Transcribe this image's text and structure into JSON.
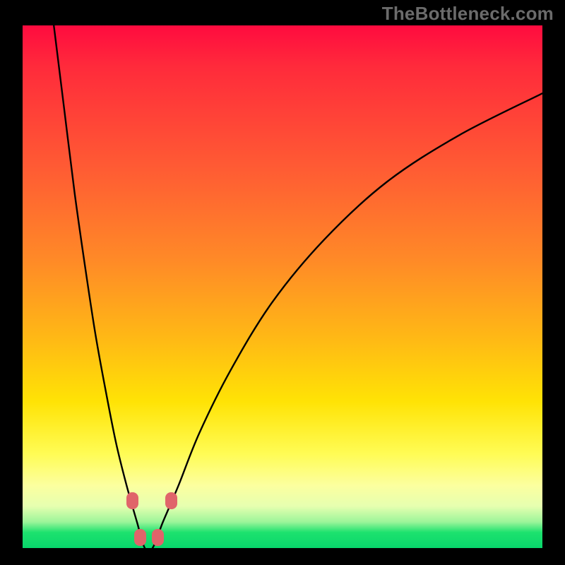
{
  "watermark": "TheBottleneck.com",
  "chart_data": {
    "type": "line",
    "title": "",
    "xlabel": "",
    "ylabel": "",
    "xlim": [
      0,
      100
    ],
    "ylim": [
      0,
      100
    ],
    "grid": false,
    "legend": false,
    "background_gradient": {
      "direction": "vertical",
      "stops": [
        {
          "pos": 0.0,
          "color": "#ff0b3f"
        },
        {
          "pos": 0.28,
          "color": "#ff5d33"
        },
        {
          "pos": 0.6,
          "color": "#ffb915"
        },
        {
          "pos": 0.82,
          "color": "#fffc55"
        },
        {
          "pos": 0.95,
          "color": "#9cf59a"
        },
        {
          "pos": 1.0,
          "color": "#08d66b"
        }
      ]
    },
    "series": [
      {
        "name": "bottleneck-curve",
        "color": "#000000",
        "description": "V-shaped curve; y appears to be a bottleneck/mismatch percentage, 0 at optimum near x≈24, rising steeply on both sides",
        "x": [
          6,
          8,
          10,
          12,
          14,
          16,
          18,
          20,
          22,
          23.5,
          25,
          27,
          30,
          34,
          40,
          48,
          58,
          70,
          84,
          100
        ],
        "y": [
          100,
          84,
          68,
          54,
          41,
          30,
          20,
          12,
          5,
          0,
          0,
          5,
          12,
          22,
          34,
          47,
          59,
          70,
          79,
          87
        ]
      }
    ],
    "markers": [
      {
        "name": "left-shoulder-1",
        "x": 21.0,
        "y": 9,
        "color": "#e0646a"
      },
      {
        "name": "left-shoulder-2",
        "x": 22.5,
        "y": 2,
        "color": "#e0646a"
      },
      {
        "name": "right-shoulder-1",
        "x": 26.0,
        "y": 2,
        "color": "#e0646a"
      },
      {
        "name": "right-shoulder-2",
        "x": 28.5,
        "y": 9,
        "color": "#e0646a"
      }
    ]
  }
}
